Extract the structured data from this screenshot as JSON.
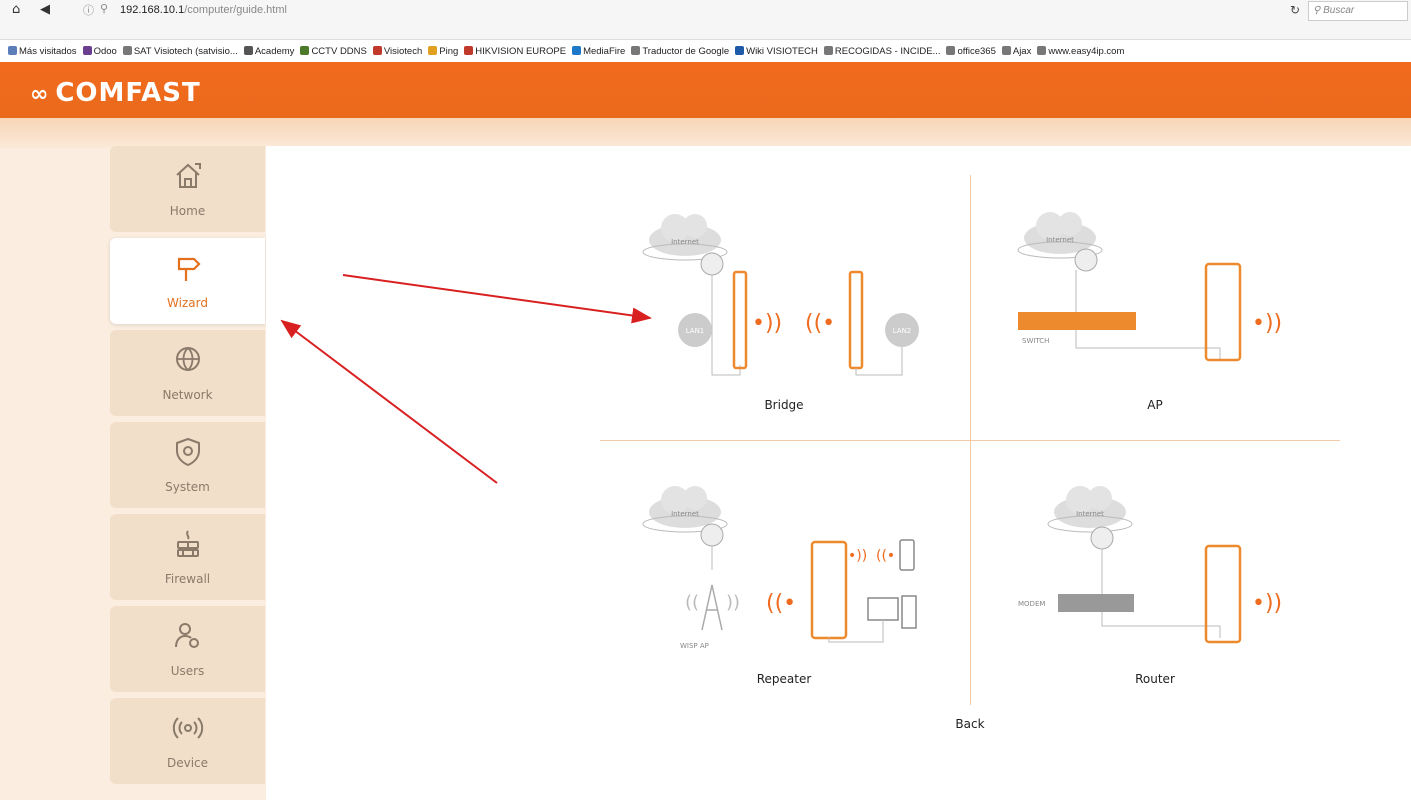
{
  "browser": {
    "url_host": "192.168.10.1",
    "url_path": "/computer/guide.html",
    "search_placeholder": "Buscar",
    "bookmarks": [
      {
        "label": "Más visitados",
        "color": "#5b7db8"
      },
      {
        "label": "Odoo",
        "color": "#6a3f8f"
      },
      {
        "label": "SAT Visiotech (satvisio...",
        "color": "#777777"
      },
      {
        "label": "Academy",
        "color": "#555555"
      },
      {
        "label": "CCTV DDNS",
        "color": "#4a7a2a"
      },
      {
        "label": "Visiotech",
        "color": "#c0392b"
      },
      {
        "label": "Ping",
        "color": "#e0a020"
      },
      {
        "label": "HIKVISION EUROPE",
        "color": "#c0392b"
      },
      {
        "label": "MediaFire",
        "color": "#1e78c8"
      },
      {
        "label": "Traductor de Google",
        "color": "#777777"
      },
      {
        "label": "Wiki VISIOTECH",
        "color": "#1e5aa8"
      },
      {
        "label": "RECOGIDAS - INCIDE...",
        "color": "#777777"
      },
      {
        "label": "office365",
        "color": "#777777"
      },
      {
        "label": "Ajax",
        "color": "#777777"
      },
      {
        "label": "www.easy4ip.com",
        "color": "#777777"
      }
    ]
  },
  "brand": {
    "name": "COMFAST",
    "accent": "#ee6b1f"
  },
  "sidebar": {
    "items": [
      {
        "label": "Home",
        "icon": "home-icon",
        "active": false
      },
      {
        "label": "Wizard",
        "icon": "signpost-icon",
        "active": true
      },
      {
        "label": "Network",
        "icon": "globe-icon",
        "active": false
      },
      {
        "label": "System",
        "icon": "shield-gear-icon",
        "active": false
      },
      {
        "label": "Firewall",
        "icon": "firewall-icon",
        "active": false
      },
      {
        "label": "Users",
        "icon": "users-icon",
        "active": false
      },
      {
        "label": "Device",
        "icon": "wireless-icon",
        "active": false
      }
    ]
  },
  "modes": [
    {
      "id": "bridge",
      "label": "Bridge"
    },
    {
      "id": "ap",
      "label": "AP"
    },
    {
      "id": "repeater",
      "label": "Repeater"
    },
    {
      "id": "router",
      "label": "Router"
    }
  ],
  "diagram_labels": {
    "internet": "Internet",
    "lan1": "LAN1",
    "lan2": "LAN2",
    "switch": "SWITCH",
    "modem": "MODEM",
    "wisp_ap": "WISP AP"
  },
  "back_label": "Back"
}
